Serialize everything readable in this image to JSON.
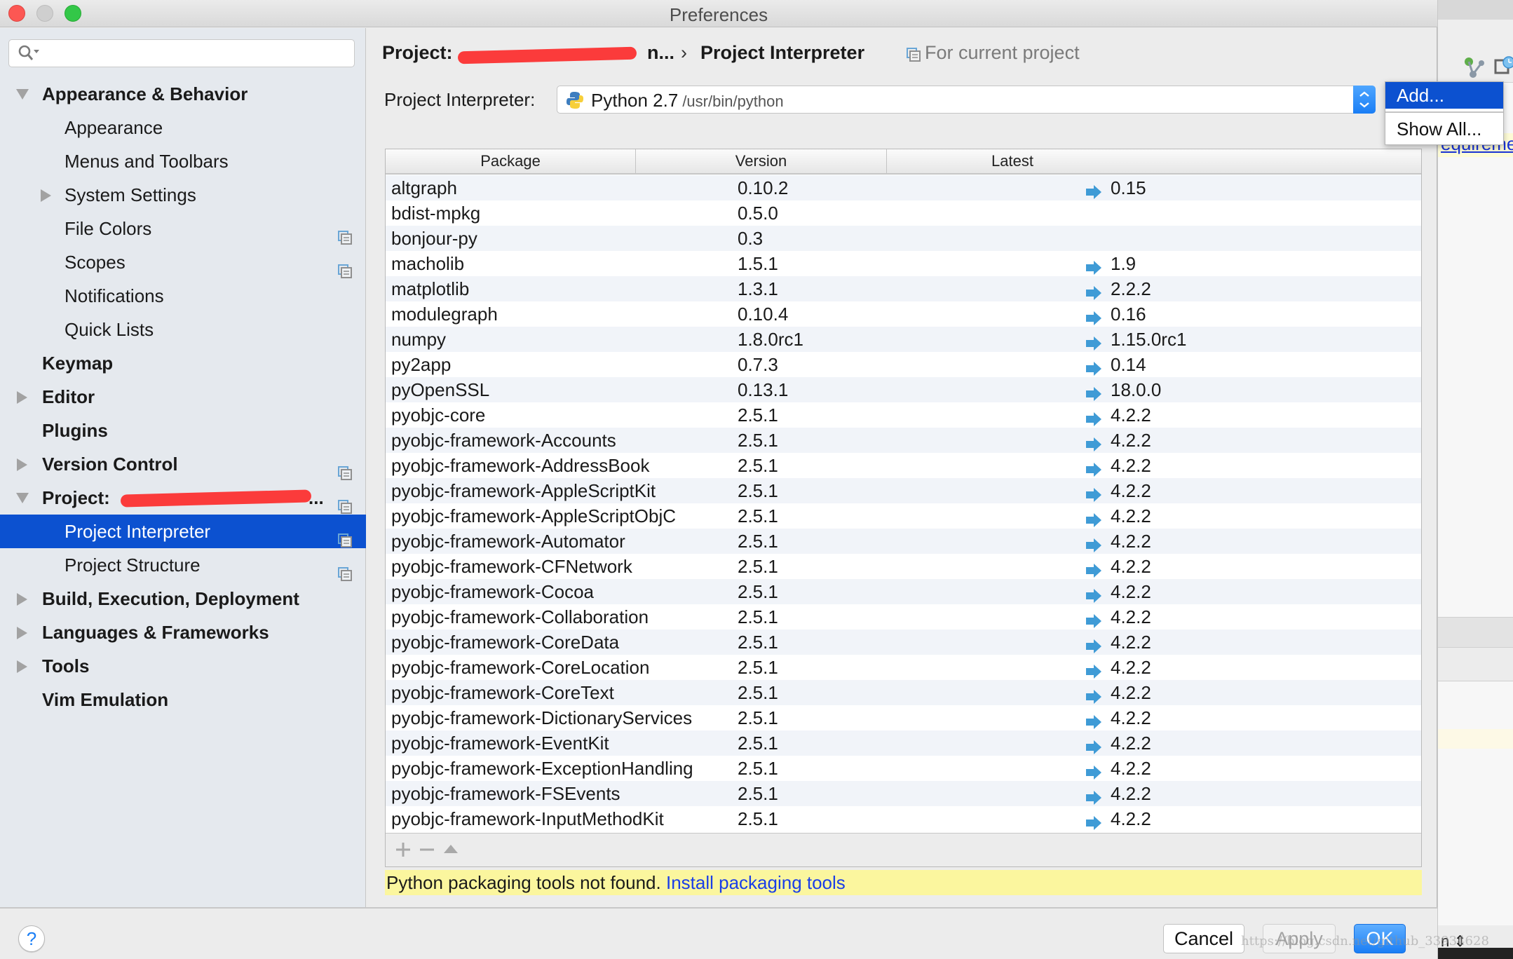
{
  "window": {
    "title": "Preferences"
  },
  "search": {
    "placeholder": "",
    "value": ""
  },
  "sidebar": {
    "items": [
      {
        "label": "Appearance & Behavior",
        "level": 0,
        "bold": true,
        "expander": "expanded"
      },
      {
        "label": "Appearance",
        "level": 1,
        "bold": false,
        "expander": "none"
      },
      {
        "label": "Menus and Toolbars",
        "level": 1,
        "bold": false,
        "expander": "none"
      },
      {
        "label": "System Settings",
        "level": 1,
        "bold": false,
        "expander": "collapsed"
      },
      {
        "label": "File Colors",
        "level": 1,
        "bold": false,
        "expander": "none",
        "project_icon": true
      },
      {
        "label": "Scopes",
        "level": 1,
        "bold": false,
        "expander": "none",
        "project_icon": true
      },
      {
        "label": "Notifications",
        "level": 1,
        "bold": false,
        "expander": "none"
      },
      {
        "label": "Quick Lists",
        "level": 1,
        "bold": false,
        "expander": "none"
      },
      {
        "label": "Keymap",
        "level": 0,
        "bold": true,
        "expander": "none"
      },
      {
        "label": "Editor",
        "level": 0,
        "bold": true,
        "expander": "collapsed"
      },
      {
        "label": "Plugins",
        "level": 0,
        "bold": true,
        "expander": "none"
      },
      {
        "label": "Version Control",
        "level": 0,
        "bold": true,
        "expander": "collapsed",
        "project_icon": true
      },
      {
        "label": "Project:",
        "level": 0,
        "bold": true,
        "expander": "expanded",
        "project_icon": true,
        "redacted": true,
        "suffix": "..."
      },
      {
        "label": "Project Interpreter",
        "level": 1,
        "bold": false,
        "expander": "none",
        "project_icon": true,
        "selected": true
      },
      {
        "label": "Project Structure",
        "level": 1,
        "bold": false,
        "expander": "none",
        "project_icon": true
      },
      {
        "label": "Build, Execution, Deployment",
        "level": 0,
        "bold": true,
        "expander": "collapsed"
      },
      {
        "label": "Languages & Frameworks",
        "level": 0,
        "bold": true,
        "expander": "collapsed"
      },
      {
        "label": "Tools",
        "level": 0,
        "bold": true,
        "expander": "collapsed"
      },
      {
        "label": "Vim Emulation",
        "level": 0,
        "bold": true,
        "expander": "none"
      }
    ]
  },
  "header": {
    "breadcrumb_project": "Project:",
    "breadcrumb_project_suffix": "n...",
    "breadcrumb_separator": "›",
    "breadcrumb_current": "Project Interpreter",
    "scope_note": "For current project"
  },
  "interpreter": {
    "label": "Project Interpreter:",
    "name": "Python 2.7",
    "path": "/usr/bin/python"
  },
  "popup_menu": {
    "items": [
      {
        "label": "Add...",
        "highlighted": true
      },
      {
        "label": "Show All...",
        "highlighted": false
      }
    ]
  },
  "table": {
    "columns": [
      "Package",
      "Version",
      "Latest"
    ],
    "rows": [
      {
        "package": "altgraph",
        "version": "0.10.2",
        "latest": "0.15",
        "upgrade": true
      },
      {
        "package": "bdist-mpkg",
        "version": "0.5.0",
        "latest": "",
        "upgrade": false
      },
      {
        "package": "bonjour-py",
        "version": "0.3",
        "latest": "",
        "upgrade": false
      },
      {
        "package": "macholib",
        "version": "1.5.1",
        "latest": "1.9",
        "upgrade": true
      },
      {
        "package": "matplotlib",
        "version": "1.3.1",
        "latest": "2.2.2",
        "upgrade": true
      },
      {
        "package": "modulegraph",
        "version": "0.10.4",
        "latest": "0.16",
        "upgrade": true
      },
      {
        "package": "numpy",
        "version": "1.8.0rc1",
        "latest": "1.15.0rc1",
        "upgrade": true
      },
      {
        "package": "py2app",
        "version": "0.7.3",
        "latest": "0.14",
        "upgrade": true
      },
      {
        "package": "pyOpenSSL",
        "version": "0.13.1",
        "latest": "18.0.0",
        "upgrade": true
      },
      {
        "package": "pyobjc-core",
        "version": "2.5.1",
        "latest": "4.2.2",
        "upgrade": true
      },
      {
        "package": "pyobjc-framework-Accounts",
        "version": "2.5.1",
        "latest": "4.2.2",
        "upgrade": true
      },
      {
        "package": "pyobjc-framework-AddressBook",
        "version": "2.5.1",
        "latest": "4.2.2",
        "upgrade": true
      },
      {
        "package": "pyobjc-framework-AppleScriptKit",
        "version": "2.5.1",
        "latest": "4.2.2",
        "upgrade": true
      },
      {
        "package": "pyobjc-framework-AppleScriptObjC",
        "version": "2.5.1",
        "latest": "4.2.2",
        "upgrade": true
      },
      {
        "package": "pyobjc-framework-Automator",
        "version": "2.5.1",
        "latest": "4.2.2",
        "upgrade": true
      },
      {
        "package": "pyobjc-framework-CFNetwork",
        "version": "2.5.1",
        "latest": "4.2.2",
        "upgrade": true
      },
      {
        "package": "pyobjc-framework-Cocoa",
        "version": "2.5.1",
        "latest": "4.2.2",
        "upgrade": true
      },
      {
        "package": "pyobjc-framework-Collaboration",
        "version": "2.5.1",
        "latest": "4.2.2",
        "upgrade": true
      },
      {
        "package": "pyobjc-framework-CoreData",
        "version": "2.5.1",
        "latest": "4.2.2",
        "upgrade": true
      },
      {
        "package": "pyobjc-framework-CoreLocation",
        "version": "2.5.1",
        "latest": "4.2.2",
        "upgrade": true
      },
      {
        "package": "pyobjc-framework-CoreText",
        "version": "2.5.1",
        "latest": "4.2.2",
        "upgrade": true
      },
      {
        "package": "pyobjc-framework-DictionaryServices",
        "version": "2.5.1",
        "latest": "4.2.2",
        "upgrade": true
      },
      {
        "package": "pyobjc-framework-EventKit",
        "version": "2.5.1",
        "latest": "4.2.2",
        "upgrade": true
      },
      {
        "package": "pyobjc-framework-ExceptionHandling",
        "version": "2.5.1",
        "latest": "4.2.2",
        "upgrade": true
      },
      {
        "package": "pyobjc-framework-FSEvents",
        "version": "2.5.1",
        "latest": "4.2.2",
        "upgrade": true
      },
      {
        "package": "pyobjc-framework-InputMethodKit",
        "version": "2.5.1",
        "latest": "4.2.2",
        "upgrade": true
      }
    ],
    "toolbar": {
      "add": "add-package",
      "remove": "uninstall-package",
      "upgrade": "upgrade-package"
    }
  },
  "notice": {
    "message": "Python packaging tools not found.",
    "link": "Install packaging tools"
  },
  "footer": {
    "help": "?",
    "cancel": "Cancel",
    "apply": "Apply",
    "ok": "OK",
    "watermark": "https://blog.csdn.net/github_33934628"
  },
  "background_ide": {
    "link_fragment": "equireme",
    "status_fragment": "n ⇕"
  },
  "colors": {
    "selection": "#0c51d0",
    "sidebar_bg": "#e5e9ee",
    "notice_bg": "#fbf69e",
    "link": "#1a3ee8",
    "upgrade_arrow": "#3f9bd6",
    "redaction": "#fb3b3b"
  }
}
